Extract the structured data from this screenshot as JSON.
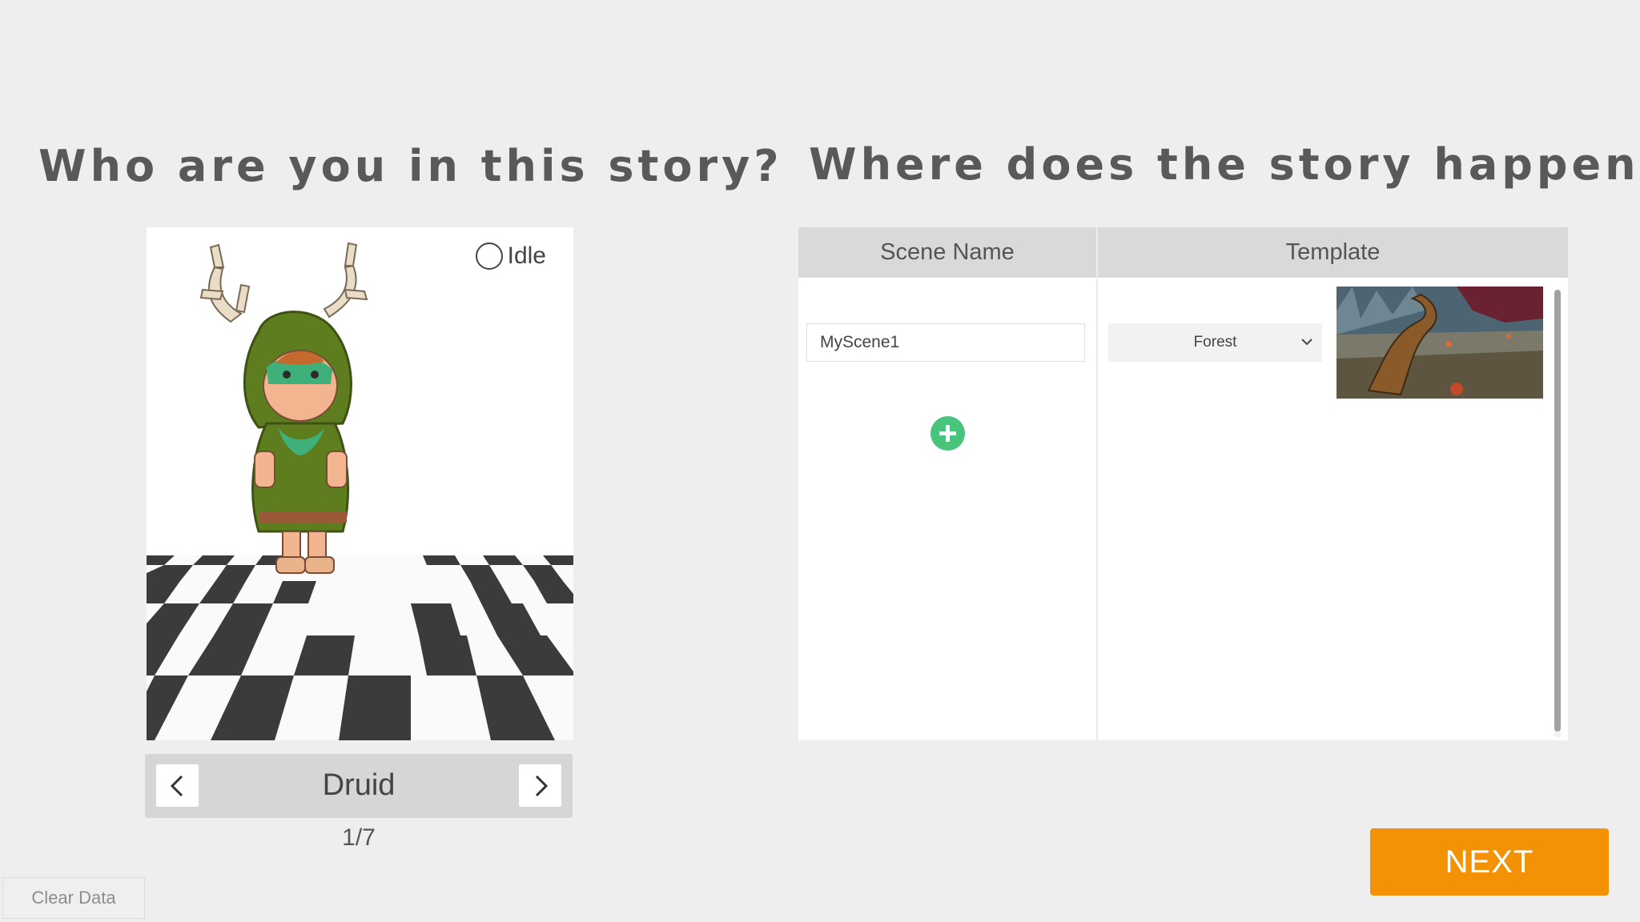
{
  "character_panel": {
    "heading": "Who are you in this story?",
    "idle_label": "Idle",
    "character_name": "Druid",
    "character_index": "1/7"
  },
  "scene_panel": {
    "heading": "Where does the story happen?",
    "columns": [
      "Scene Name",
      "Template"
    ],
    "scenes": [
      {
        "name": "MyScene1",
        "template": "Forest"
      }
    ]
  },
  "footer": {
    "next_label": "NEXT",
    "clear_label": "Clear Data"
  },
  "colors": {
    "background": "#eeeeee",
    "heading": "#595959",
    "next_button": "#f39204",
    "add_button": "#49c47c",
    "table_header": "#d9d9d9"
  },
  "icons": [
    "radio-circle-icon",
    "chevron-left-icon",
    "chevron-right-icon",
    "chevron-down-icon",
    "plus-icon"
  ]
}
